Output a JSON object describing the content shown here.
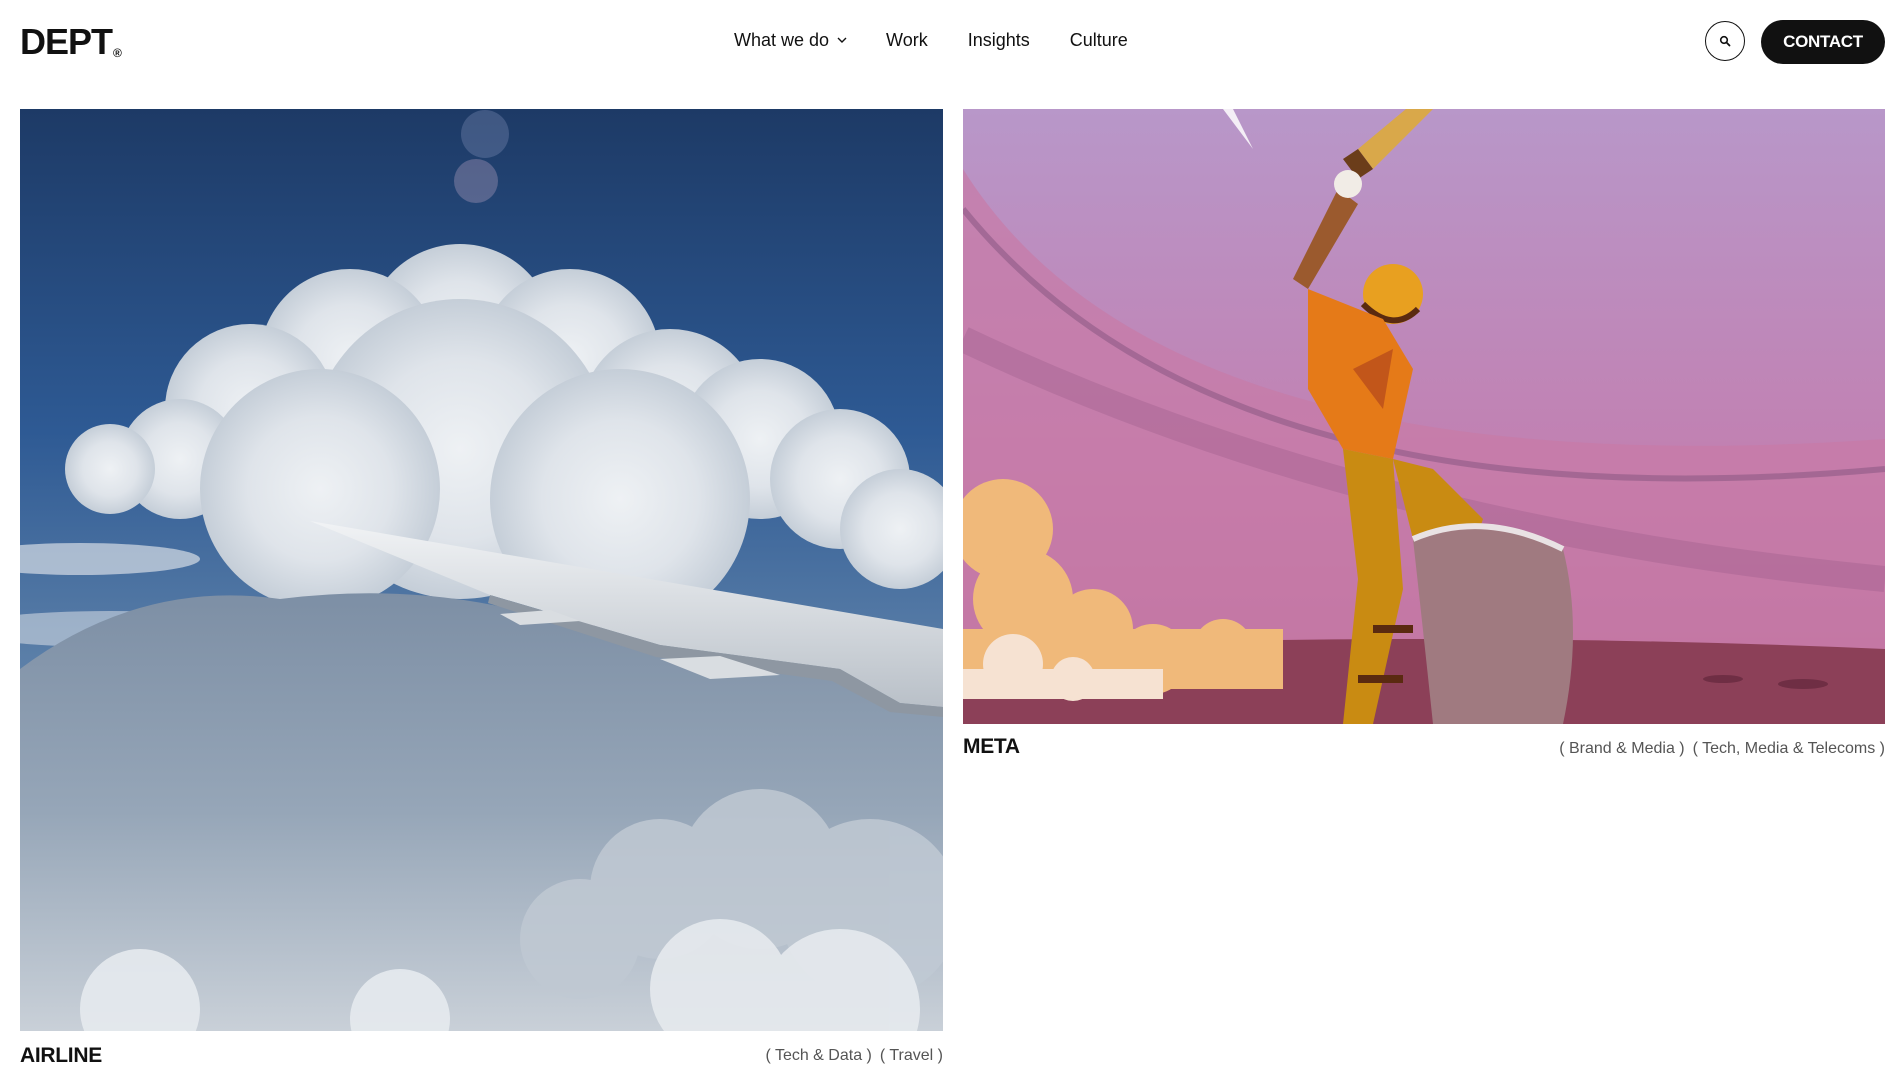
{
  "header": {
    "logo": "DEPT",
    "logo_mark": "®",
    "nav": [
      {
        "label": "What we do",
        "has_dropdown": true
      },
      {
        "label": "Work"
      },
      {
        "label": "Insights"
      },
      {
        "label": "Culture"
      }
    ],
    "search_icon": "search-icon",
    "contact_label": "CONTACT"
  },
  "cards": [
    {
      "title": "AIRLINE",
      "tags": [
        "( Tech & Data )",
        "( Travel )"
      ],
      "image": "airplane-wing-above-clouds"
    },
    {
      "title": "META",
      "tags": [
        "( Brand & Media )",
        "( Tech, Media & Telecoms )"
      ],
      "image": "illustrated-cricket-batsman"
    }
  ],
  "colors": {
    "text": "#111111",
    "tag_text": "#555555",
    "contact_bg": "#111111",
    "background": "#ffffff"
  }
}
